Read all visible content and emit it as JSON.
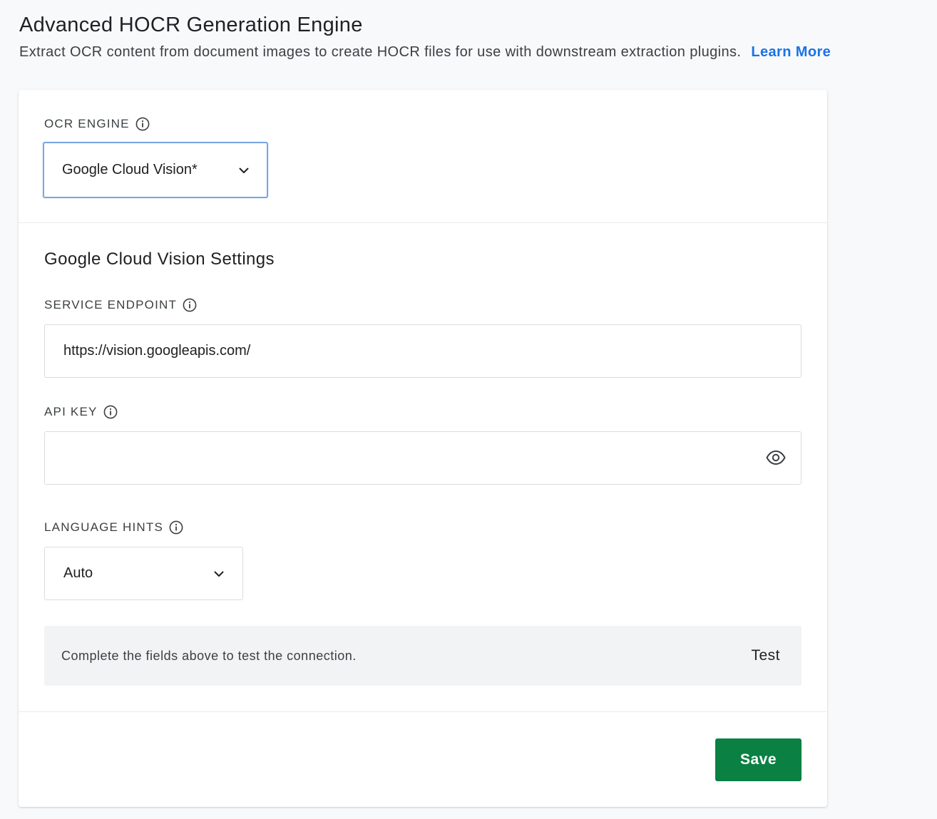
{
  "header": {
    "title": "Advanced HOCR Generation Engine",
    "description": "Extract OCR content from document images to create HOCR files for use with downstream extraction plugins.",
    "learn_more": "Learn More"
  },
  "ocr_engine": {
    "label": "OCR ENGINE",
    "selected": "Google Cloud Vision*"
  },
  "settings": {
    "title": "Google Cloud Vision Settings",
    "service_endpoint": {
      "label": "SERVICE ENDPOINT",
      "value": "https://vision.googleapis.com/"
    },
    "api_key": {
      "label": "API KEY",
      "value": ""
    },
    "language_hints": {
      "label": "LANGUAGE HINTS",
      "selected": "Auto"
    }
  },
  "test_panel": {
    "message": "Complete the fields above to test the connection.",
    "button": "Test"
  },
  "footer": {
    "save": "Save"
  },
  "colors": {
    "accent": "#1a73e8",
    "save": "#0b8043",
    "focus_border": "#7aa7e0"
  },
  "icons": [
    "info-icon",
    "chevron-down-icon",
    "eye-icon"
  ]
}
